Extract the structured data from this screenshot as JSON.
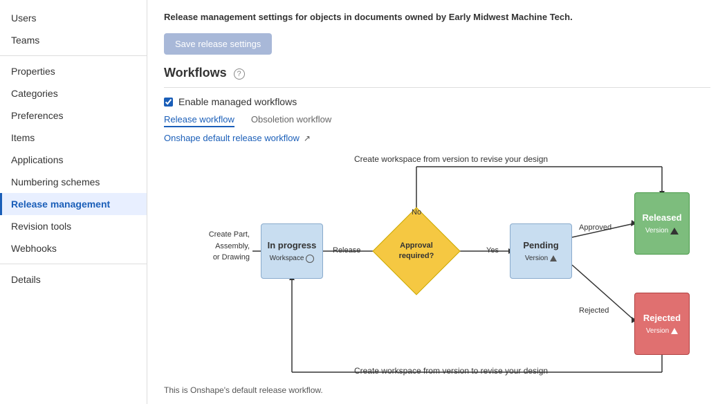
{
  "sidebar": {
    "items": [
      {
        "id": "users",
        "label": "Users",
        "active": false
      },
      {
        "id": "teams",
        "label": "Teams",
        "active": false
      },
      {
        "id": "properties",
        "label": "Properties",
        "active": false
      },
      {
        "id": "categories",
        "label": "Categories",
        "active": false
      },
      {
        "id": "preferences",
        "label": "Preferences",
        "active": false
      },
      {
        "id": "items",
        "label": "Items",
        "active": false
      },
      {
        "id": "applications",
        "label": "Applications",
        "active": false
      },
      {
        "id": "numbering-schemes",
        "label": "Numbering schemes",
        "active": false
      },
      {
        "id": "release-management",
        "label": "Release management",
        "active": true
      },
      {
        "id": "revision-tools",
        "label": "Revision tools",
        "active": false
      },
      {
        "id": "webhooks",
        "label": "Webhooks",
        "active": false
      },
      {
        "id": "details",
        "label": "Details",
        "active": false
      }
    ]
  },
  "main": {
    "description": "Release management settings for objects in documents owned by Early Midwest Machine Tech.",
    "save_button_label": "Save release settings",
    "section_title": "Workflows",
    "checkbox_label": "Enable managed workflows",
    "tab_release": "Release workflow",
    "tab_obsoletion": "Obsoletion workflow",
    "workflow_link_label": "Onshape default release workflow",
    "diagram": {
      "top_label": "Create workspace from version to revise your design",
      "bottom_label": "Create workspace from version to revise your design",
      "create_label": "Create Part,\nAssembly,\nor Drawing",
      "in_progress_label": "In progress",
      "in_progress_sub": "Workspace",
      "release_label": "Release",
      "no_label": "No",
      "approval_label": "Approval\nrequired?",
      "yes_label": "Yes",
      "pending_label": "Pending",
      "pending_sub": "Version",
      "approved_label": "Approved",
      "approved_arrow_label": "Approved",
      "rejected_arrow_label": "Rejected",
      "released_label": "Released",
      "released_sub": "Version",
      "rejected_label": "Rejected",
      "rejected_sub": "Version"
    },
    "footer_note": "This is Onshape's default release workflow."
  }
}
